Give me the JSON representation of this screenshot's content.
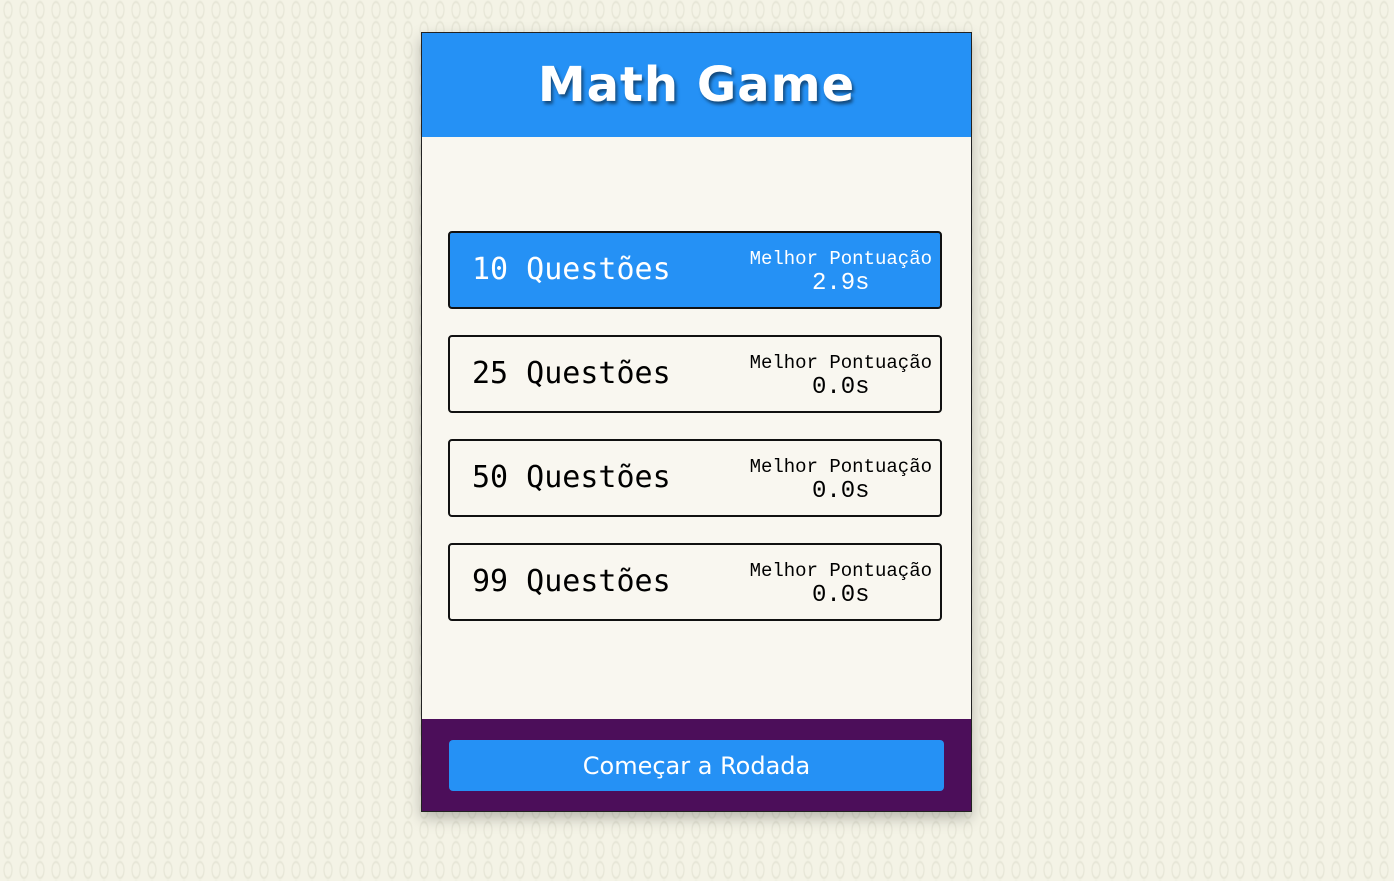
{
  "header": {
    "title": "Math Game"
  },
  "options": [
    {
      "label": "10 Questões",
      "best_label": "Melhor Pontuação",
      "best_value": "2.9s",
      "selected": true
    },
    {
      "label": "25 Questões",
      "best_label": "Melhor Pontuação",
      "best_value": "0.0s",
      "selected": false
    },
    {
      "label": "50 Questões",
      "best_label": "Melhor Pontuação",
      "best_value": "0.0s",
      "selected": false
    },
    {
      "label": "99 Questões",
      "best_label": "Melhor Pontuação",
      "best_value": "0.0s",
      "selected": false
    }
  ],
  "footer": {
    "start_label": "Começar a Rodada"
  },
  "colors": {
    "accent": "#2591f5",
    "footer": "#4c0e5a",
    "background": "#f4f3e6"
  }
}
